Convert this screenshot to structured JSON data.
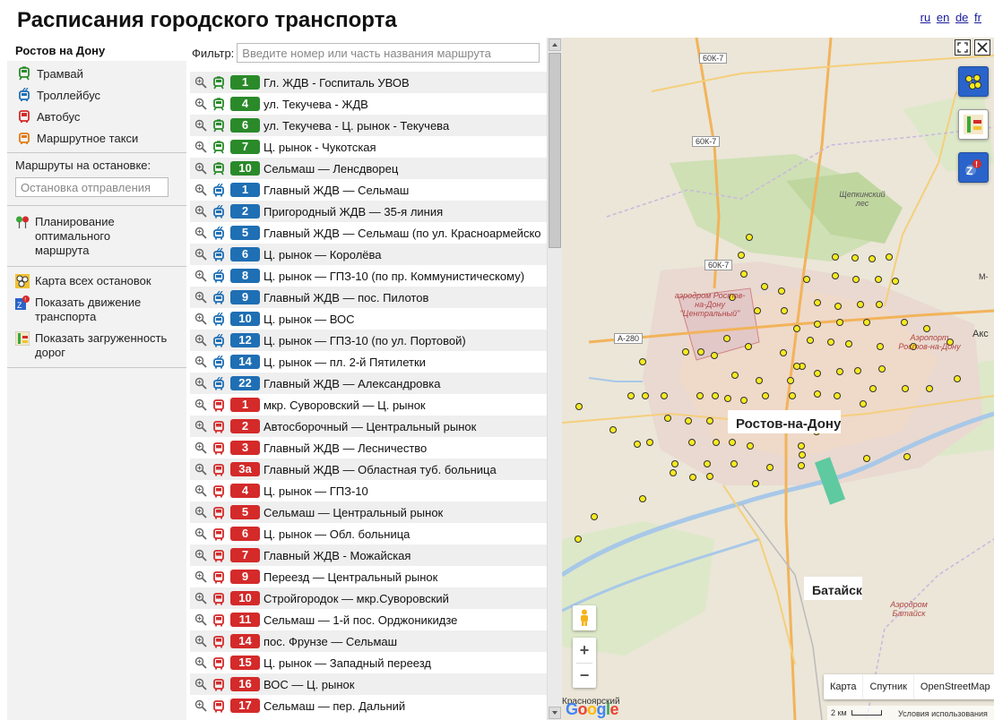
{
  "header": {
    "title": "Расписания городского транспорта",
    "languages": [
      "ru",
      "en",
      "de",
      "fr"
    ]
  },
  "sidebar": {
    "city": "Ростов на Дону",
    "types": [
      {
        "label": "Трамвай",
        "icon": "tram-icon",
        "color": "#2a8a2a"
      },
      {
        "label": "Троллейбус",
        "icon": "trolleybus-icon",
        "color": "#1f6fb4"
      },
      {
        "label": "Автобус",
        "icon": "bus-icon",
        "color": "#d42a2a"
      },
      {
        "label": "Маршрутное такси",
        "icon": "minibus-icon",
        "color": "#e07b10"
      }
    ],
    "stop_label": "Маршруты на остановке:",
    "stop_placeholder": "Остановка отправления",
    "planning": "Планирование оптимального маршрута",
    "tools": [
      {
        "label": "Карта всех остановок",
        "icon": "stops-map-icon"
      },
      {
        "label": "Показать движение транспорта",
        "icon": "vehicle-tracking-icon"
      },
      {
        "label": "Показать загруженность дорог",
        "icon": "traffic-icon"
      }
    ]
  },
  "filter": {
    "label": "Фильтр:",
    "placeholder": "Введите номер или часть названия маршрута"
  },
  "routes": [
    {
      "type": "tram",
      "num": "1",
      "name": "Гл. ЖДВ - Госпиталь УВОВ"
    },
    {
      "type": "tram",
      "num": "4",
      "name": "ул. Текучева - ЖДВ"
    },
    {
      "type": "tram",
      "num": "6",
      "name": "ул. Текучева - Ц. рынок - Текучева"
    },
    {
      "type": "tram",
      "num": "7",
      "name": "Ц. рынок - Чукотская"
    },
    {
      "type": "tram",
      "num": "10",
      "name": "Сельмаш — Ленсдворец"
    },
    {
      "type": "trolley",
      "num": "1",
      "name": "Главный ЖДВ — Сельмаш"
    },
    {
      "type": "trolley",
      "num": "2",
      "name": "Пригородный ЖДВ — 35-я линия"
    },
    {
      "type": "trolley",
      "num": "5",
      "name": "Главный ЖДВ — Сельмаш (по ул. Красноармейско"
    },
    {
      "type": "trolley",
      "num": "6",
      "name": "Ц. рынок — Королёва"
    },
    {
      "type": "trolley",
      "num": "8",
      "name": "Ц. рынок — ГПЗ-10 (по пр. Коммунистическому)"
    },
    {
      "type": "trolley",
      "num": "9",
      "name": "Главный ЖДВ — пос. Пилотов"
    },
    {
      "type": "trolley",
      "num": "10",
      "name": "Ц. рынок — ВОС"
    },
    {
      "type": "trolley",
      "num": "12",
      "name": "Ц. рынок — ГПЗ-10 (по ул. Портовой)"
    },
    {
      "type": "trolley",
      "num": "14",
      "name": "Ц. рынок — пл. 2-й Пятилетки"
    },
    {
      "type": "trolley",
      "num": "22",
      "name": "Главный ЖДВ — Александровка"
    },
    {
      "type": "bus",
      "num": "1",
      "name": "мкр. Суворовский — Ц. рынок"
    },
    {
      "type": "bus",
      "num": "2",
      "name": "Автосборочный — Центральный рынок"
    },
    {
      "type": "bus",
      "num": "3",
      "name": "Главный ЖДВ — Лесничество"
    },
    {
      "type": "bus",
      "num": "3а",
      "name": "Главный ЖДВ — Областная туб. больница"
    },
    {
      "type": "bus",
      "num": "4",
      "name": "Ц. рынок — ГПЗ-10"
    },
    {
      "type": "bus",
      "num": "5",
      "name": "Сельмаш — Центральный рынок"
    },
    {
      "type": "bus",
      "num": "6",
      "name": "Ц. рынок — Обл. больница"
    },
    {
      "type": "bus",
      "num": "7",
      "name": "Главный ЖДВ - Можайская"
    },
    {
      "type": "bus",
      "num": "9",
      "name": "Переезд — Центральный рынок"
    },
    {
      "type": "bus",
      "num": "10",
      "name": "Стройгородок — мкр.Суворовский"
    },
    {
      "type": "bus",
      "num": "11",
      "name": "Сельмаш — 1-й пос. Орджоникидзе"
    },
    {
      "type": "bus",
      "num": "14",
      "name": "пос. Фрунзе — Сельмаш"
    },
    {
      "type": "bus",
      "num": "15",
      "name": "Ц. рынок — Западный переезд"
    },
    {
      "type": "bus",
      "num": "16",
      "name": "ВОС — Ц. рынок"
    },
    {
      "type": "bus",
      "num": "17",
      "name": "Сельмаш — пер. Дальний"
    }
  ],
  "type_colors": {
    "tram": "#2a8a2a",
    "trolley": "#1f6fb4",
    "bus": "#d42a2a"
  },
  "map": {
    "labels": {
      "rostov": "Ростов-на-Дону",
      "bataysk": "Батайск",
      "forest": "Щепкинский лес",
      "airport1": "аэродром Ростов-на-Дону \"Центральный\"",
      "airport2": "Аэропорт Ростов-на-Дону",
      "airport3": "Аэродром Батайск",
      "aks": "Акс",
      "m": "М-",
      "krasnod": "Красноярский"
    },
    "roads": [
      "60К-7",
      "60К-7",
      "60К-7",
      "А-280"
    ],
    "map_types": [
      "Карта",
      "Спутник",
      "OpenStreetMap"
    ],
    "scale": "2 км",
    "terms": "Условия использования",
    "zoom_in": "+",
    "zoom_out": "−",
    "logo": "Google"
  }
}
